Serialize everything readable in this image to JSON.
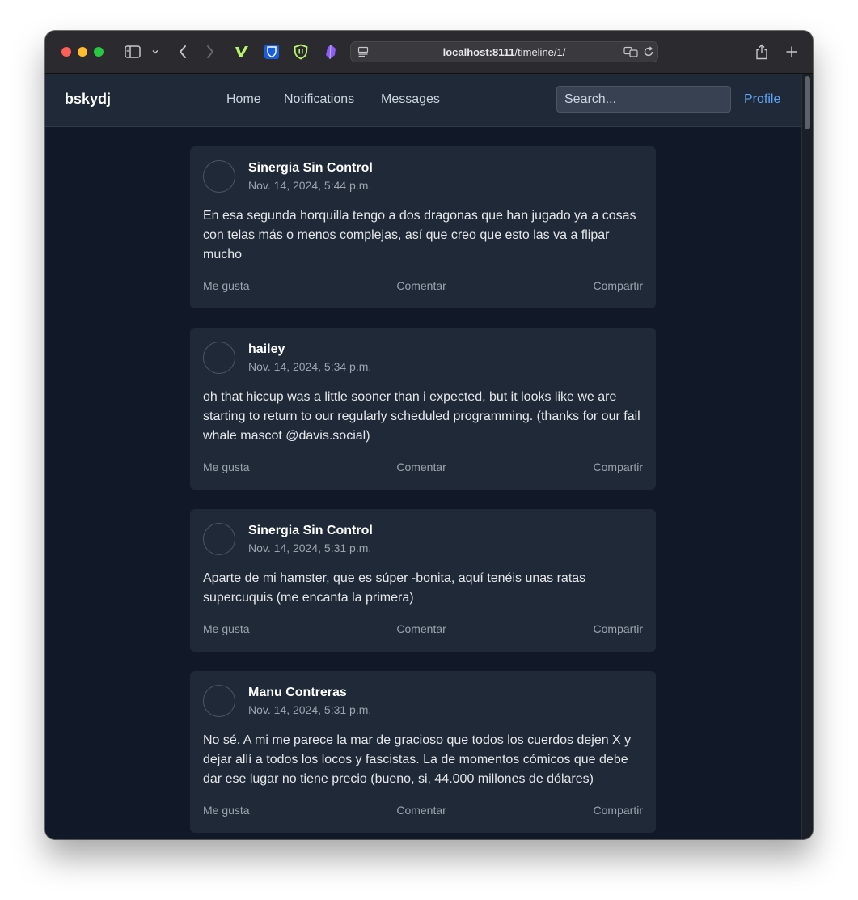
{
  "browser": {
    "url_host": "localhost:8111",
    "url_path": "/timeline/1/"
  },
  "nav": {
    "brand": "bskydj",
    "links": [
      "Home",
      "Notifications",
      "Messages"
    ],
    "search_placeholder": "Search...",
    "profile": "Profile"
  },
  "posts": [
    {
      "author": "Sinergia Sin Control",
      "date": "Nov. 14, 2024, 5:44 p.m.",
      "content": "En esa segunda horquilla tengo a dos dragonas que han jugado ya a cosas con telas más o menos complejas, así que creo que esto las va a flipar mucho",
      "like": "Me gusta",
      "comment": "Comentar",
      "share": "Compartir"
    },
    {
      "author": "hailey",
      "date": "Nov. 14, 2024, 5:34 p.m.",
      "content": "oh that hiccup was a little sooner than i expected, but it looks like we are starting to return to our regularly scheduled programming. (thanks for our fail whale mascot @davis.social)",
      "like": "Me gusta",
      "comment": "Comentar",
      "share": "Compartir"
    },
    {
      "author": "Sinergia Sin Control",
      "date": "Nov. 14, 2024, 5:31 p.m.",
      "content": "Aparte de mi hamster, que es súper -bonita, aquí tenéis unas ratas supercuquis (me encanta la primera)",
      "like": "Me gusta",
      "comment": "Comentar",
      "share": "Compartir"
    },
    {
      "author": "Manu Contreras",
      "date": "Nov. 14, 2024, 5:31 p.m.",
      "content": "No sé. A mi me parece la mar de gracioso que todos los cuerdos dejen X y dejar allí a todos los locos y fascistas. La de momentos cómicos que debe dar ese lugar no tiene precio (bueno, si, 44.000 millones de dólares)",
      "like": "Me gusta",
      "comment": "Comentar",
      "share": "Compartir"
    }
  ],
  "icons": {
    "sidebar": "sidebar-icon",
    "back": "back-arrow-icon",
    "forward": "forward-arrow-icon",
    "share": "share-icon",
    "new_tab": "plus-icon",
    "translate": "translate-icon",
    "reload": "reload-icon"
  },
  "colors": {
    "page_bg": "#111827",
    "card_bg": "#1f2937",
    "accent": "#60a5fa"
  }
}
